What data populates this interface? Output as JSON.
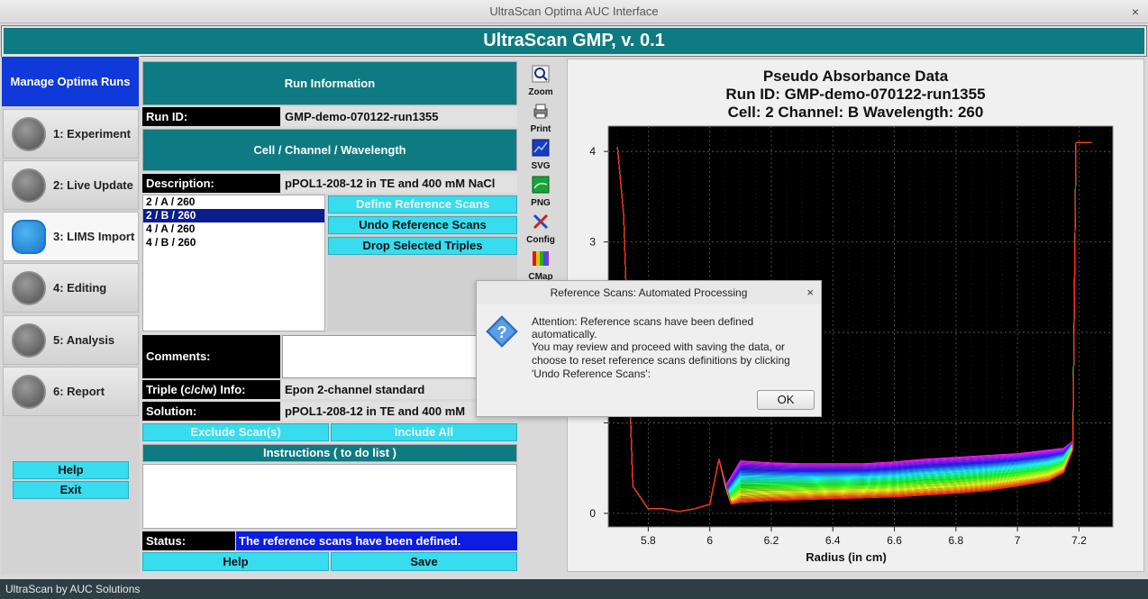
{
  "window": {
    "title": "UltraScan Optima AUC Interface",
    "close_glyph": "×"
  },
  "app": {
    "banner": "UltraScan GMP, v. 0.1",
    "footer": "UltraScan by AUC Solutions"
  },
  "nav": {
    "title": "Manage Optima Runs",
    "items": [
      {
        "label": "1: Experiment",
        "icon": "gear-icon"
      },
      {
        "label": "2: Live Update",
        "icon": "refresh-icon"
      },
      {
        "label": "3: LIMS Import",
        "icon": "cloud-database-icon"
      },
      {
        "label": "4: Editing",
        "icon": "edit-list-icon"
      },
      {
        "label": "5: Analysis",
        "icon": "magnifier-chart-icon"
      },
      {
        "label": "6: Report",
        "icon": "report-icon"
      }
    ],
    "active_index": 2,
    "help_label": "Help",
    "exit_label": "Exit"
  },
  "run": {
    "section_run_info": "Run Information",
    "run_id_label": "Run ID:",
    "run_id": "GMP-demo-070122-run1355",
    "section_ccw": "Cell / Channel / Wavelength",
    "description_label": "Description:",
    "description": "pPOL1-208-12 in TE and 400 mM NaCl",
    "triples": [
      "2 / A / 260",
      "2 / B / 260",
      "4 / A / 260",
      "4 / B / 260"
    ],
    "selected_triple": 1,
    "define_ref_label": "Define Reference Scans",
    "undo_ref_label": "Undo Reference Scans",
    "drop_triples_label": "Drop Selected Triples",
    "comments_label": "Comments:",
    "comments_value": "",
    "triple_info_label": "Triple (c/c/w) Info:",
    "triple_info": "Epon 2-channel standard",
    "solution_label": "Solution:",
    "solution": "pPOL1-208-12 in TE and 400 mM",
    "exclude_label": "Exclude Scan(s)",
    "include_all_label": "Include All",
    "instructions_label": "Instructions ( to do list )",
    "status_label": "Status:",
    "status": "The reference scans have been defined.",
    "help_label": "Help",
    "save_label": "Save"
  },
  "toolbar": [
    "Zoom",
    "Print",
    "SVG",
    "PNG",
    "Config",
    "CMap"
  ],
  "dialog": {
    "title": "Reference Scans: Automated Processing",
    "line1": "Attention: Reference scans have been defined automatically.",
    "line2": "You may review and proceed with saving the data, or choose to reset reference scans definitions by clicking 'Undo Reference Scans':",
    "ok_label": "OK",
    "close_glyph": "×",
    "icon": "question-icon"
  },
  "chart_data": {
    "type": "line",
    "title_lines": [
      "Pseudo Absorbance Data",
      "Run ID: GMP-demo-070122-run1355",
      "Cell: 2  Channel: B  Wavelength: 260"
    ],
    "xlabel": "Radius (in cm)",
    "ylabel": "",
    "xlim": [
      5.67,
      7.31
    ],
    "ylim": [
      -0.15,
      4.28
    ],
    "xticks": [
      5.8,
      6,
      6.2,
      6.4,
      6.6,
      6.8,
      7,
      7.2
    ],
    "xtick_labels": [
      "5.8",
      "6",
      "6.2",
      "6.4",
      "6.6",
      "6.8",
      "7",
      "7.2"
    ],
    "yticks": [
      0,
      1,
      2,
      3,
      4
    ],
    "ytick_labels": [
      "0",
      "",
      "",
      "3",
      "4"
    ],
    "grid": true,
    "background": "#000000",
    "scan_count": 40,
    "meniscus_x": 6.05,
    "reference_meniscus_x": 5.75,
    "base_x": 7.18,
    "series_profile": {
      "x": [
        5.7,
        5.72,
        5.75,
        5.8,
        5.85,
        5.9,
        5.95,
        6.0,
        6.03,
        6.05,
        6.1,
        6.2,
        6.3,
        6.4,
        6.5,
        6.6,
        6.7,
        6.8,
        6.9,
        7.0,
        7.05,
        7.1,
        7.15,
        7.18
      ],
      "y_first": [
        4.05,
        3.3,
        0.3,
        0.05,
        0.05,
        0.02,
        0.05,
        0.1,
        0.6,
        0.3,
        0.58,
        0.56,
        0.55,
        0.55,
        0.55,
        0.57,
        0.6,
        0.62,
        0.64,
        0.66,
        0.68,
        0.7,
        0.72,
        0.8
      ],
      "y_last": [
        4.05,
        3.3,
        0.3,
        0.05,
        0.05,
        0.02,
        0.05,
        0.1,
        0.6,
        0.1,
        0.12,
        0.14,
        0.15,
        0.16,
        0.17,
        0.18,
        0.2,
        0.22,
        0.25,
        0.3,
        0.33,
        0.36,
        0.45,
        0.7
      ]
    }
  }
}
